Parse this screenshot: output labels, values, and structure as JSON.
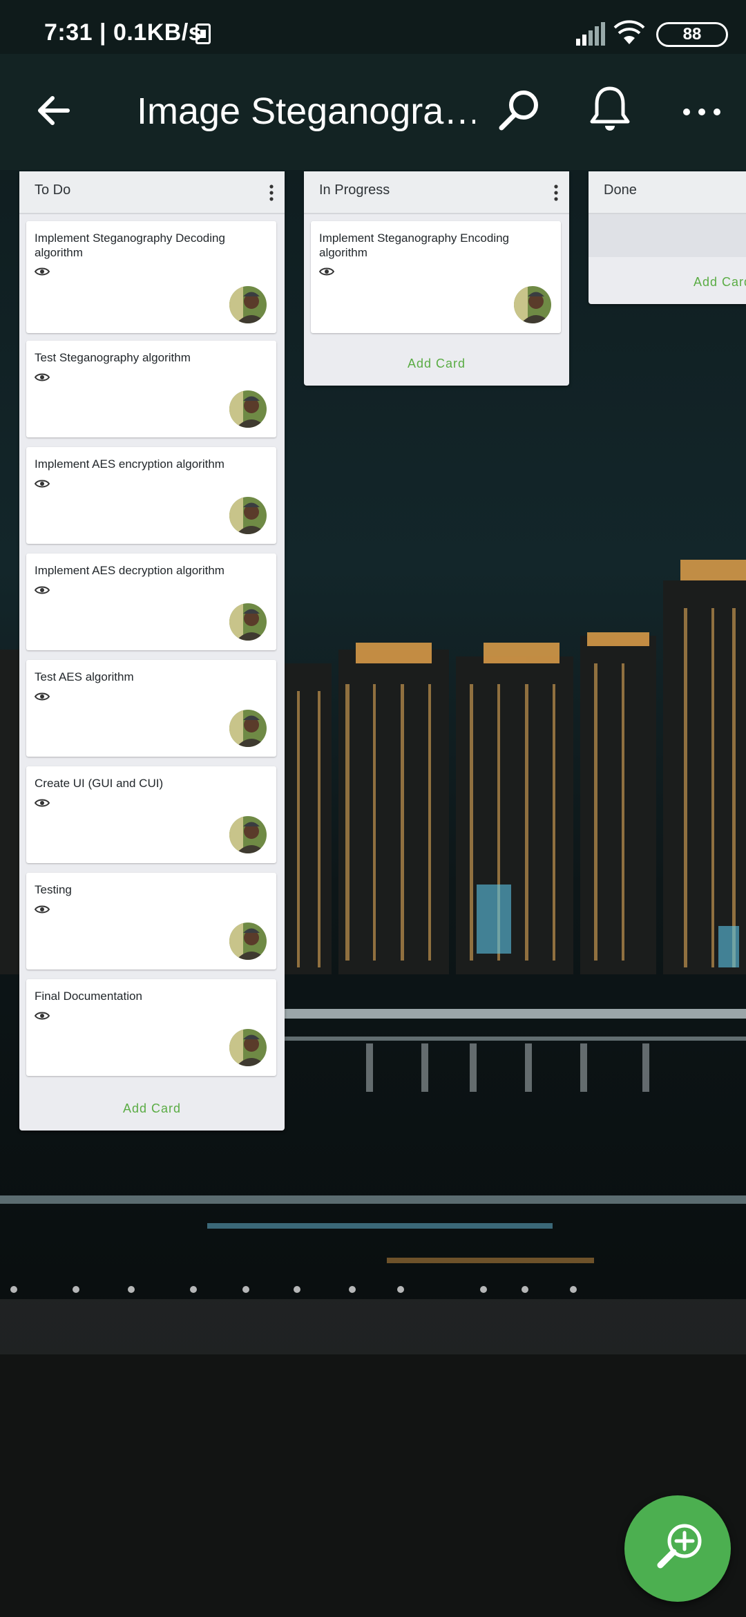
{
  "status_bar": {
    "time_speed": "7:31 | 0.1KB/s",
    "battery": "88"
  },
  "app_bar": {
    "title": "Image Steganogra…",
    "back_icon": "arrow-left-icon",
    "search_icon": "search-icon",
    "notifications_icon": "bell-icon",
    "more_icon": "more-horizontal-icon"
  },
  "lists": [
    {
      "title": "To Do",
      "add_card": "Add Card",
      "cards": [
        {
          "title": "Implement Steganography Decoding algorithm"
        },
        {
          "title": "Test Steganography algorithm"
        },
        {
          "title": "Implement AES encryption algorithm"
        },
        {
          "title": "Implement AES decryption algorithm"
        },
        {
          "title": "Test AES algorithm"
        },
        {
          "title": "Create UI (GUI and CUI)"
        },
        {
          "title": "Testing"
        },
        {
          "title": "Final Documentation"
        }
      ]
    },
    {
      "title": "In Progress",
      "add_card": "Add Card",
      "cards": [
        {
          "title": "Implement Steganography Encoding algorithm"
        }
      ]
    },
    {
      "title": "Done",
      "add_card": "Add Card",
      "cards": []
    }
  ],
  "fab_icon": "zoom-in-icon",
  "colors": {
    "accent": "#5aac44",
    "fab": "#4caf50",
    "app_bar": "#132323"
  }
}
